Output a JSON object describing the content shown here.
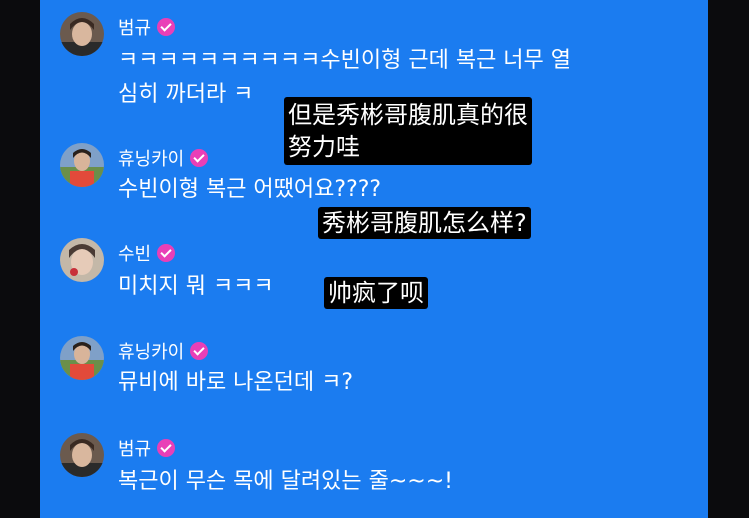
{
  "messages": [
    {
      "name": "범규",
      "lines": [
        "ㅋㅋㅋㅋㅋㅋㅋㅋㅋㅋ수빈이형 근데 복근 너무 열",
        "심히 까더라 ㅋ"
      ],
      "subtitle": [
        "但是秀彬哥腹肌真的很",
        "努力哇"
      ]
    },
    {
      "name": "휴닝카이",
      "lines": [
        "수빈이형 복근 어땠어요????"
      ],
      "subtitle": [
        "秀彬哥腹肌怎么样?"
      ]
    },
    {
      "name": "수빈",
      "lines": [
        "미치지 뭐 ㅋㅋㅋ"
      ],
      "subtitle": [
        "帅疯了呗"
      ]
    },
    {
      "name": "휴닝카이",
      "lines": [
        "뮤비에 바로 나온던데 ㅋ?"
      ]
    },
    {
      "name": "범규",
      "lines": [
        "복근이 무슨 목에 달려있는 줄~~~!"
      ]
    }
  ],
  "colors": {
    "background": "#1b7cf0",
    "verified_badge": "#e93fb7",
    "subtitle_bg": "#000000"
  },
  "icons": {
    "verified": "verified-check-icon"
  }
}
